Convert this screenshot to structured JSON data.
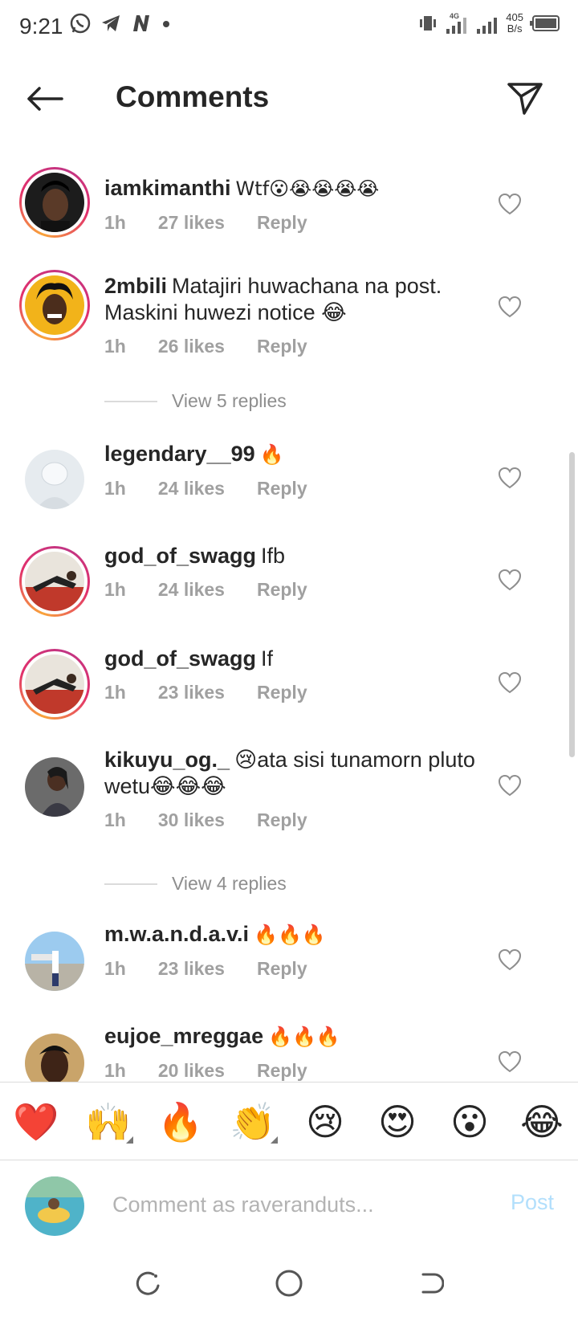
{
  "status_bar": {
    "time": "9:21",
    "network": "4G",
    "speed_value": "405",
    "speed_unit": "B/s"
  },
  "header": {
    "title": "Comments"
  },
  "comments": [
    {
      "username": "iamkimanthi",
      "text": "Wtf😮😭😭😭😭",
      "time": "1h",
      "likes": "27 likes",
      "reply": "Reply"
    },
    {
      "username": "2mbili",
      "text": "Matajiri huwachana na post. Maskini huwezi notice 😂",
      "time": "1h",
      "likes": "26 likes",
      "reply": "Reply"
    },
    {
      "username": "legendary__99",
      "text": "🔥",
      "time": "1h",
      "likes": "24 likes",
      "reply": "Reply"
    },
    {
      "username": "god_of_swagg",
      "text": "Ifb",
      "time": "1h",
      "likes": "24 likes",
      "reply": "Reply"
    },
    {
      "username": "god_of_swagg",
      "text": "If",
      "time": "1h",
      "likes": "23 likes",
      "reply": "Reply"
    },
    {
      "username": "kikuyu_og._",
      "text": "😢ata sisi tunamorn pluto wetu😂😂😂",
      "time": "1h",
      "likes": "30 likes",
      "reply": "Reply"
    },
    {
      "username": "m.w.a.n.d.a.v.i",
      "text": "🔥🔥🔥",
      "time": "1h",
      "likes": "23 likes",
      "reply": "Reply"
    },
    {
      "username": "eujoe_mreggae",
      "text": "🔥🔥🔥",
      "time": "1h",
      "likes": "20 likes",
      "reply": "Reply"
    }
  ],
  "view_replies": [
    {
      "label": "View 5 replies"
    },
    {
      "label": "View 4 replies"
    }
  ],
  "emoji_bar": [
    "❤️",
    "🙌",
    "🔥",
    "👏",
    "😢",
    "😍",
    "😮",
    "😂"
  ],
  "composer": {
    "placeholder": "Comment as raveranduts...",
    "post_label": "Post"
  },
  "colors": {
    "accent_blue": "#0095f6",
    "post_disabled": "#b2dffc",
    "ring_start": "#f9a43a",
    "ring_end": "#c13584",
    "meta_gray": "#a0a0a0"
  }
}
